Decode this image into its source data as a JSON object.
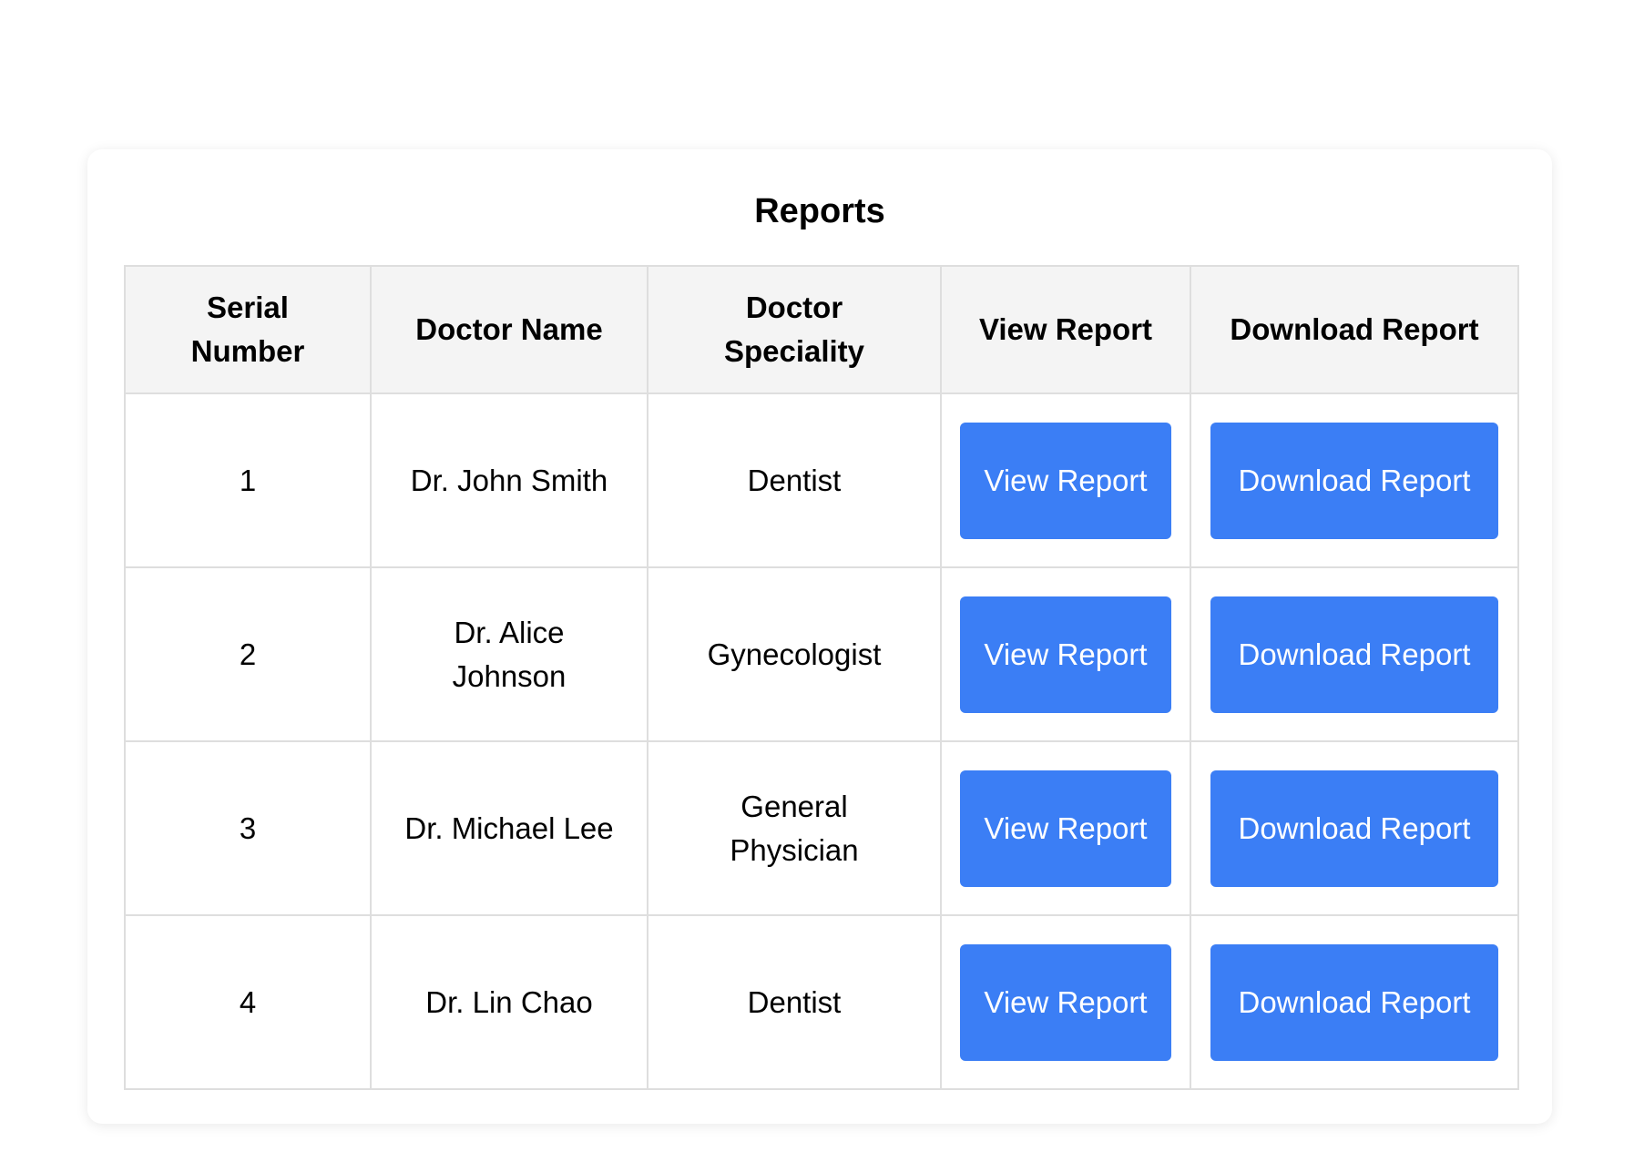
{
  "card": {
    "title": "Reports"
  },
  "table": {
    "headers": {
      "serial": "Serial Number",
      "doctor_name": "Doctor Name",
      "speciality": "Doctor Speciality",
      "view": "View Report",
      "download": "Download Report"
    },
    "rows": [
      {
        "serial": "1",
        "doctor_name": "Dr. John Smith",
        "speciality": "Dentist",
        "view_label": "View Report",
        "download_label": "Download Report"
      },
      {
        "serial": "2",
        "doctor_name": "Dr. Alice Johnson",
        "speciality": "Gynecologist",
        "view_label": "View Report",
        "download_label": "Download Report"
      },
      {
        "serial": "3",
        "doctor_name": "Dr. Michael Lee",
        "speciality": "General Physician",
        "view_label": "View Report",
        "download_label": "Download Report"
      },
      {
        "serial": "4",
        "doctor_name": "Dr. Lin Chao",
        "speciality": "Dentist",
        "view_label": "View Report",
        "download_label": "Download Report"
      }
    ]
  },
  "colors": {
    "button": "#3b7ef5",
    "header_bg": "#f4f4f4",
    "border": "#dedede"
  }
}
